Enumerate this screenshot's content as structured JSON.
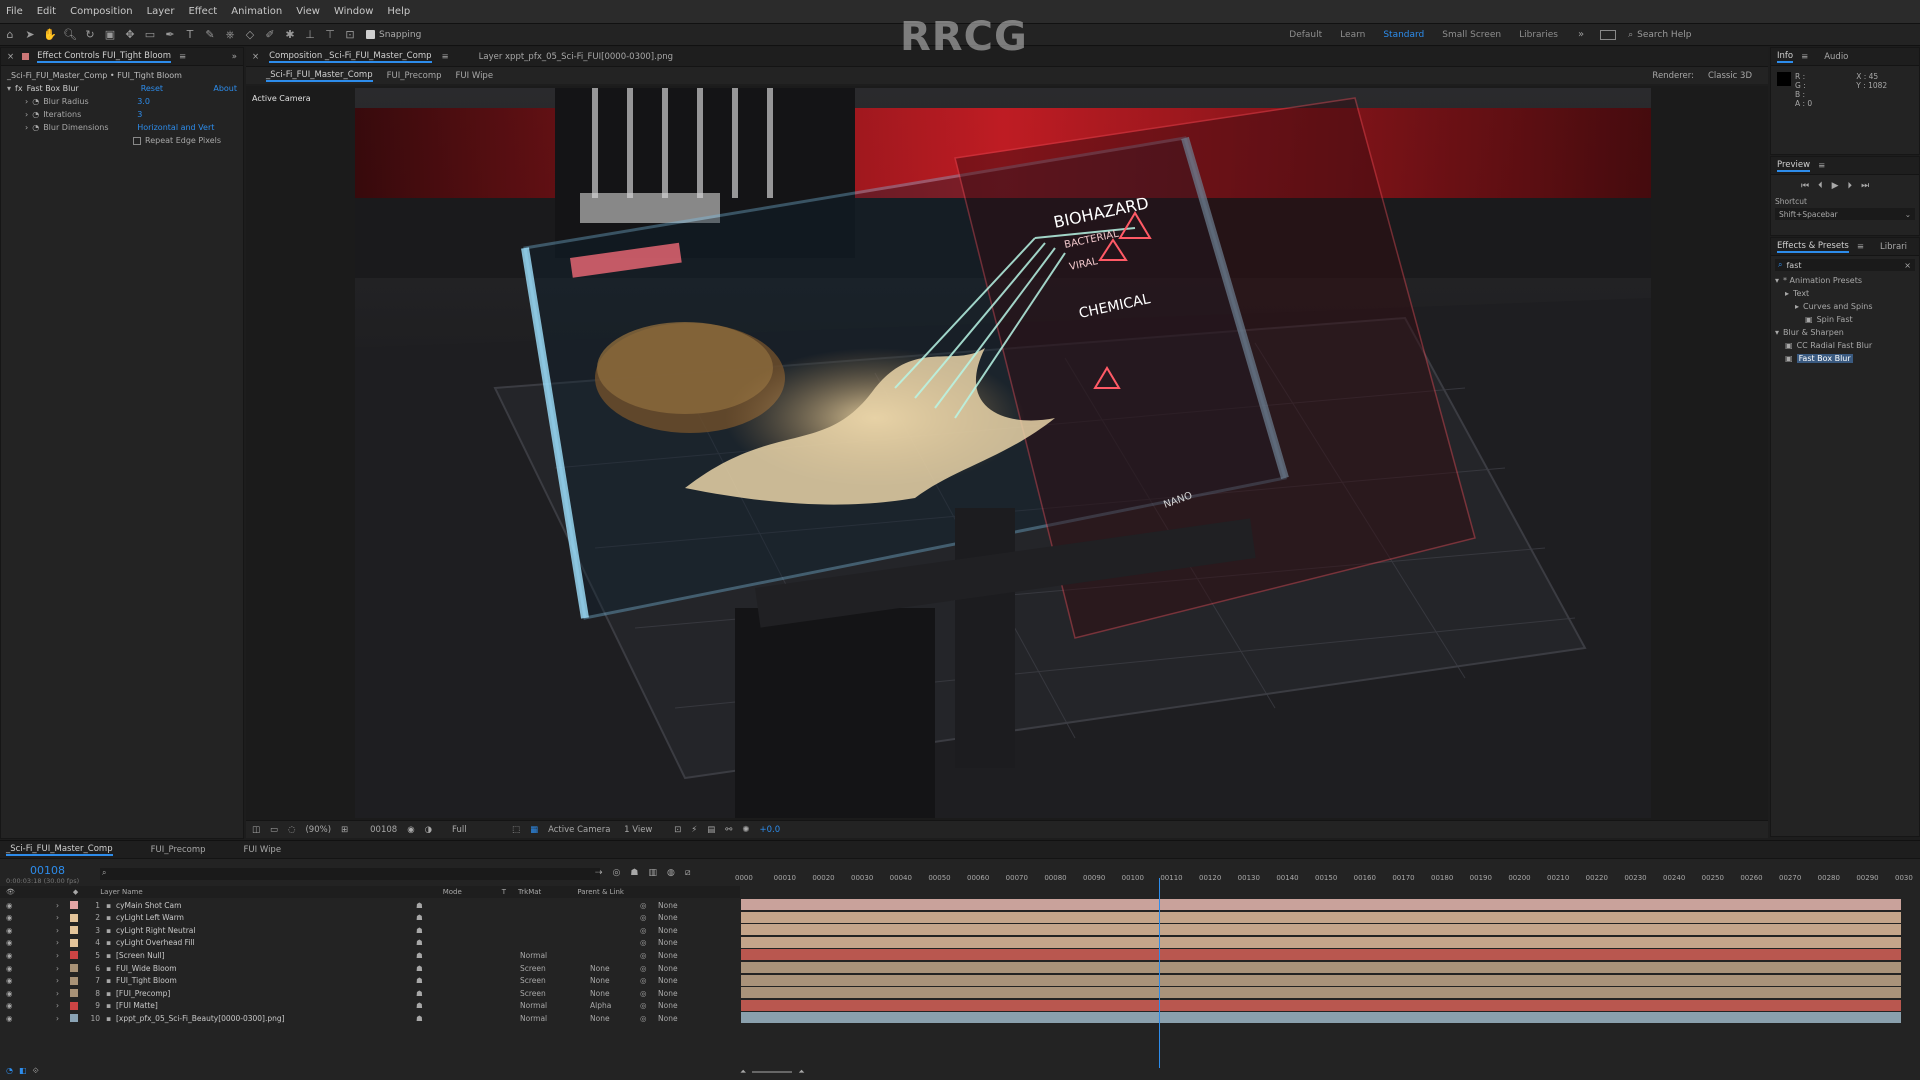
{
  "menu": [
    "File",
    "Edit",
    "Composition",
    "Layer",
    "Effect",
    "Animation",
    "View",
    "Window",
    "Help"
  ],
  "toolbar": {
    "snapping": "Snapping"
  },
  "workspaces": [
    "Default",
    "Learn",
    "Standard",
    "Small Screen",
    "Libraries"
  ],
  "search_help": "Search Help",
  "brand_watermark": "RRCG",
  "effect_controls": {
    "tab": "Effect Controls  FUI_Tight Bloom",
    "composition_tab": "Composition  _Sci-Fi_FUI_Master_Comp",
    "layer_tab": "Layer  xppt_pfx_05_Sci-Fi_FUI[0000-0300].png",
    "breadcrumb": "_Sci-Fi_FUI_Master_Comp • FUI_Tight Bloom",
    "effect_name": "Fast Box Blur",
    "reset": "Reset",
    "about": "About",
    "props": [
      {
        "label": "Blur Radius",
        "value": "3.0"
      },
      {
        "label": "Iterations",
        "value": "3"
      },
      {
        "label": "Blur Dimensions",
        "value": "Horizontal and Vert"
      }
    ],
    "checkbox": "Repeat Edge Pixels"
  },
  "comp_flow": [
    "_Sci-Fi_FUI_Master_Comp",
    "FUI_Precomp",
    "FUI Wipe"
  ],
  "renderer": {
    "label": "Renderer:",
    "value": "Classic 3D"
  },
  "viewer": {
    "label": "Active Camera",
    "hud": [
      "BIOHAZARD",
      "BACTERIAL",
      "VIRAL",
      "CHEMICAL",
      "NANO"
    ],
    "footer": {
      "zoom": "(90%)",
      "time": "00108",
      "quality": "Full",
      "camera": "Active Camera",
      "views": "1 View",
      "exposure": "+0.0"
    }
  },
  "info": {
    "tabs": [
      "Info",
      "Audio"
    ],
    "rgb": [
      "R :",
      "G :",
      "B :",
      "A : 0"
    ],
    "coords": [
      "X : 45",
      "Y : 1082"
    ]
  },
  "preview": {
    "title": "Preview",
    "shortcut_label": "Shortcut",
    "shortcut": "Shift+Spacebar"
  },
  "effects_presets": {
    "tabs": [
      "Effects & Presets",
      "Librari"
    ],
    "search": "fast",
    "tree": [
      {
        "label": "* Animation Presets",
        "indent": 0
      },
      {
        "label": "Text",
        "indent": 1
      },
      {
        "label": "Curves and Spins",
        "indent": 2
      },
      {
        "label": "Spin Fast",
        "indent": 3
      },
      {
        "label": "Blur & Sharpen",
        "indent": 0
      },
      {
        "label": "CC Radial Fast Blur",
        "indent": 1
      },
      {
        "label": "Fast Box Blur",
        "indent": 1,
        "selected": true
      }
    ]
  },
  "timeline": {
    "tabs": [
      "_Sci-Fi_FUI_Master_Comp",
      "FUI_Precomp",
      "FUI Wipe"
    ],
    "current_time": "00108",
    "fps": "0:00:03:18 (30.00 fps)",
    "headers": {
      "layer_name": "Layer Name",
      "mode": "Mode",
      "t": "T",
      "trkmat": "TrkMat",
      "parent": "Parent & Link"
    },
    "ruler": [
      "0000",
      "00010",
      "00020",
      "00030",
      "00040",
      "00050",
      "00060",
      "00070",
      "00080",
      "00090",
      "00100",
      "00110",
      "00120",
      "00130",
      "00140",
      "00150",
      "00160",
      "00170",
      "00180",
      "00190",
      "00200",
      "00210",
      "00220",
      "00230",
      "00240",
      "00250",
      "00260",
      "00270",
      "00280",
      "00290",
      "0030"
    ],
    "playhead_fraction": 0.36,
    "layers": [
      {
        "num": "1",
        "name": "cyMain Shot Cam",
        "color": "#e4a5a5",
        "mode": "",
        "trkmat": "",
        "parent": "None",
        "bar": "#c9a29b"
      },
      {
        "num": "2",
        "name": "cyLight Left Warm",
        "color": "#e3c49a",
        "mode": "",
        "trkmat": "",
        "parent": "None",
        "bar": "#c4a58a"
      },
      {
        "num": "3",
        "name": "cyLight Right Neutral",
        "color": "#e3c49a",
        "mode": "",
        "trkmat": "",
        "parent": "None",
        "bar": "#c4a58a"
      },
      {
        "num": "4",
        "name": "cyLight Overhead Fill",
        "color": "#e3c49a",
        "mode": "",
        "trkmat": "",
        "parent": "None",
        "bar": "#c4a58a"
      },
      {
        "num": "5",
        "name": "[Screen Null]",
        "color": "#c44",
        "mode": "Normal",
        "trkmat": "",
        "parent": "None",
        "bar": "#b9574f"
      },
      {
        "num": "6",
        "name": "FUI_Wide Bloom",
        "color": "#a89277",
        "mode": "Screen",
        "trkmat": "None",
        "parent": "None",
        "bar": "#a9937a"
      },
      {
        "num": "7",
        "name": "FUI_Tight Bloom",
        "color": "#a89277",
        "mode": "Screen",
        "trkmat": "None",
        "parent": "None",
        "bar": "#a9937a"
      },
      {
        "num": "8",
        "name": "[FUI_Precomp]",
        "color": "#a89277",
        "mode": "Screen",
        "trkmat": "None",
        "parent": "None",
        "bar": "#a9937a"
      },
      {
        "num": "9",
        "name": "[FUI Matte]",
        "color": "#c44",
        "mode": "Normal",
        "trkmat": "Alpha",
        "parent": "None",
        "bar": "#b9574f"
      },
      {
        "num": "10",
        "name": "[xppt_pfx_05_Sci-Fi_Beauty[0000-0300].png]",
        "color": "#8aa3b5",
        "mode": "Normal",
        "trkmat": "None",
        "parent": "None",
        "bar": "#8aa0ad"
      }
    ]
  }
}
